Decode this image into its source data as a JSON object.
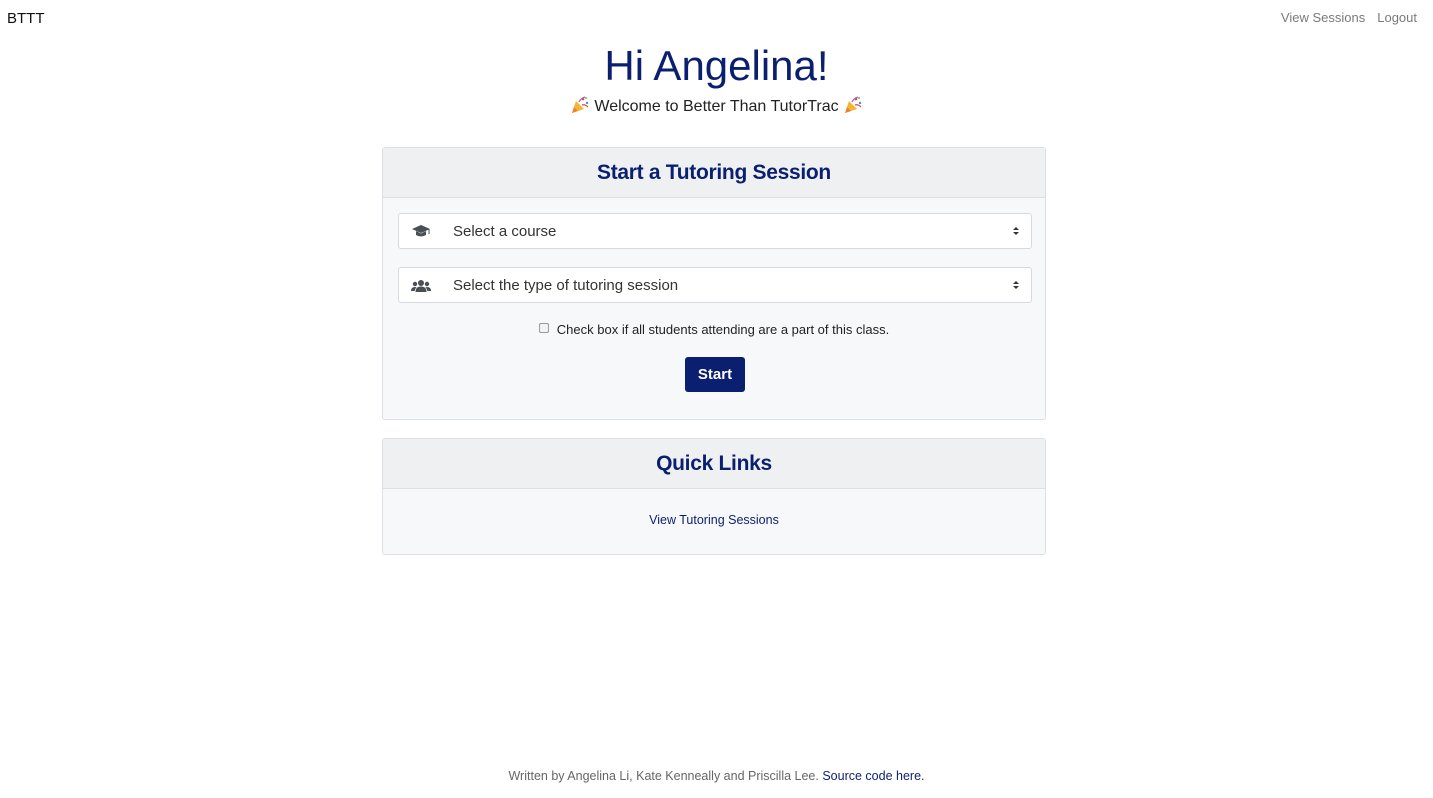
{
  "nav": {
    "brand": "BTTT",
    "links": [
      "View Sessions",
      "Logout"
    ]
  },
  "hero": {
    "greeting": "Hi Angelina!",
    "welcome": "Welcome to Better Than TutorTrac"
  },
  "start_card": {
    "title": "Start a Tutoring Session",
    "course_select": {
      "value": "Select a course",
      "icon": "graduation-cap-icon"
    },
    "type_select": {
      "value": "Select the type of tutoring session",
      "icon": "users-icon"
    },
    "checkbox_label": "Check box if all students attending are a part of this class.",
    "checkbox_checked": false,
    "start_button": "Start"
  },
  "quick_links": {
    "title": "Quick Links",
    "items": [
      "View Tutoring Sessions"
    ]
  },
  "footer": {
    "text": "Written by Angelina Li, Kate Kenneally and Priscilla Lee.",
    "link_text": "Source code here."
  },
  "colors": {
    "primary": "#0b1f70",
    "card_header_bg": "#eef0f2",
    "card_body_bg": "#f7f8fa",
    "muted_link": "#7a7a7a"
  }
}
